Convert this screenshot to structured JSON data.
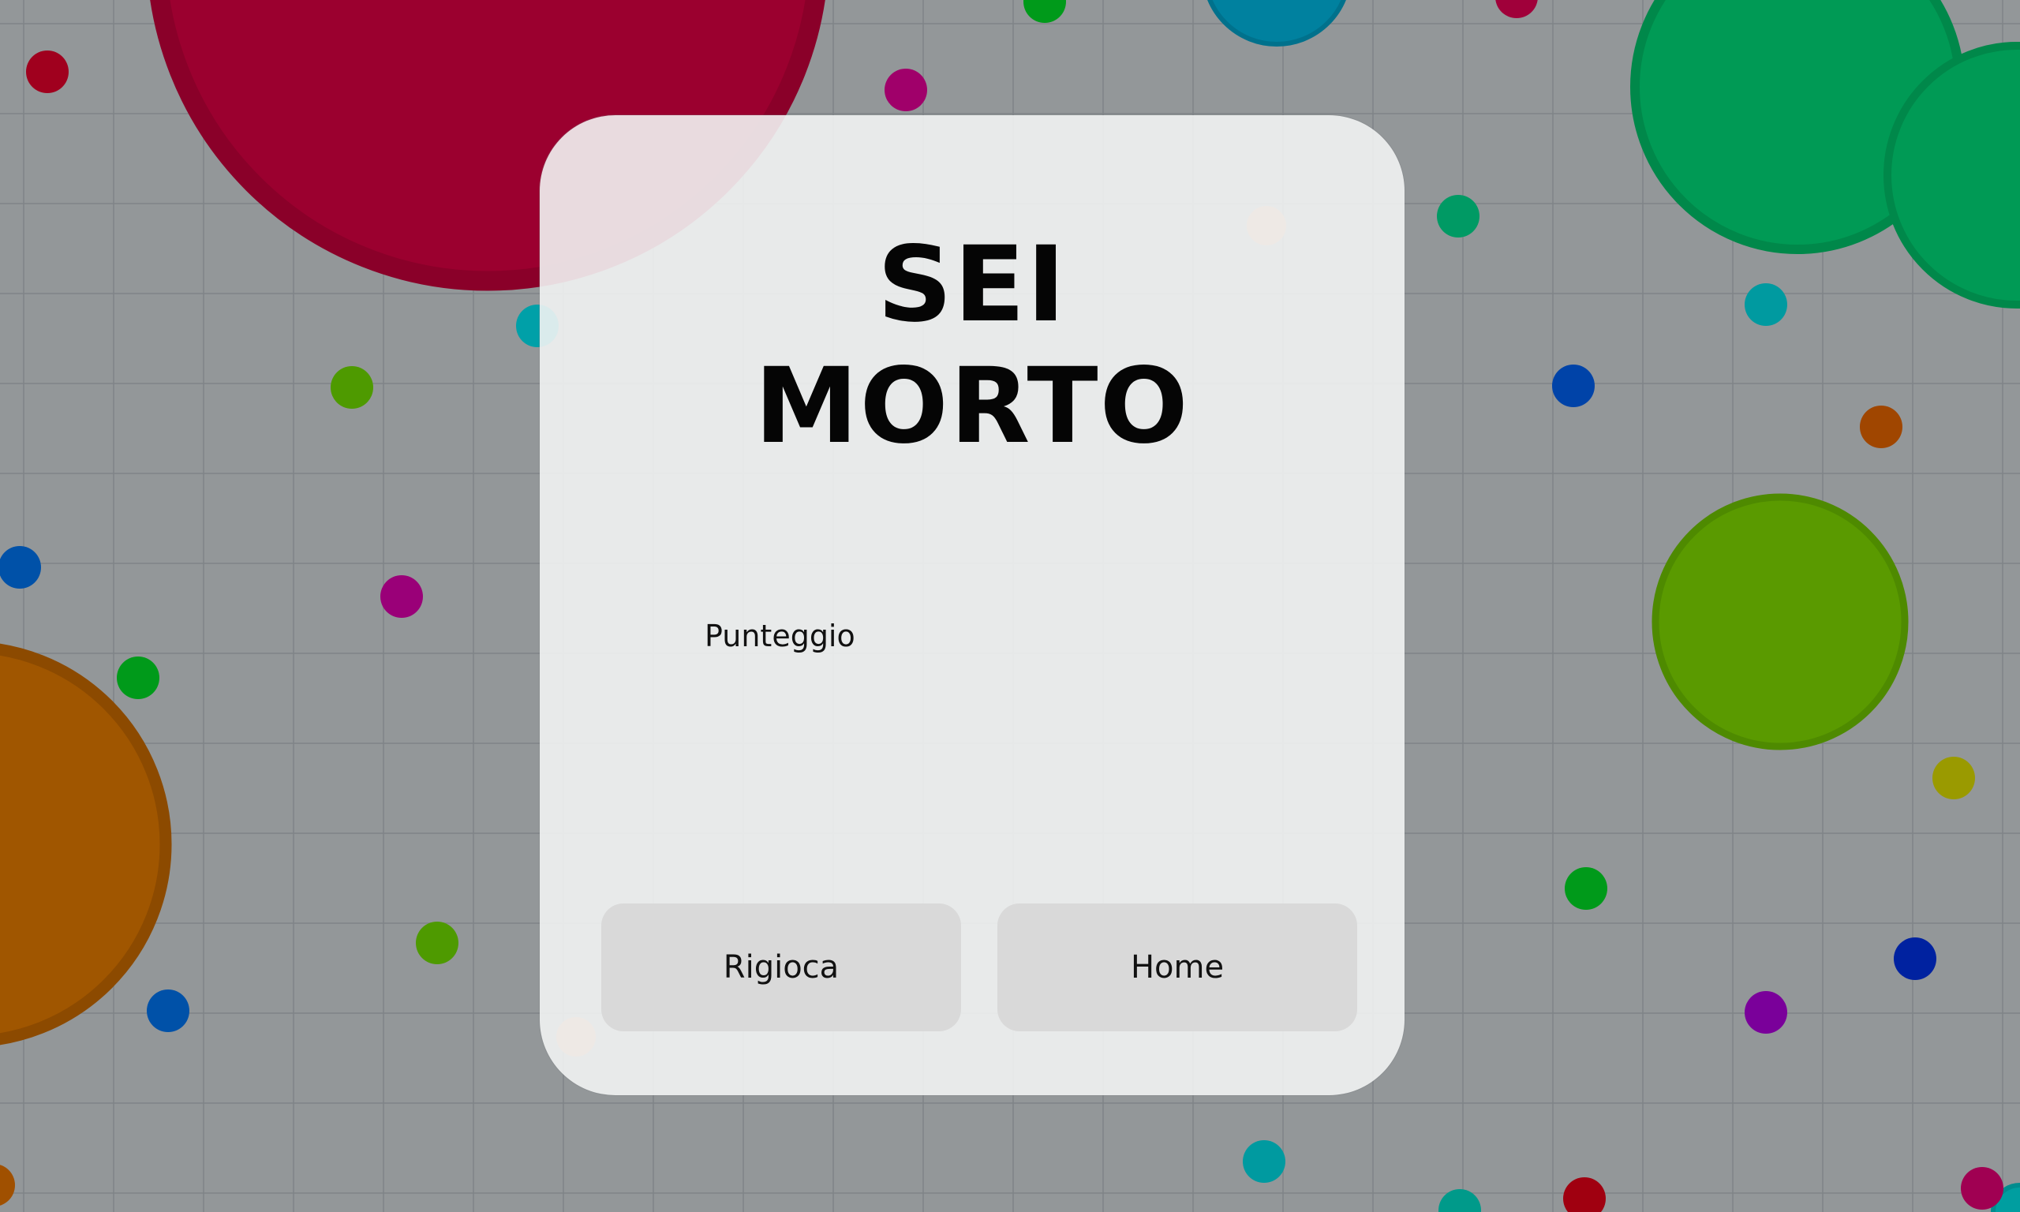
{
  "game": {
    "background_color": "#939799",
    "grid_line_color": "#7f8487",
    "cells": [
      {
        "color": "#9b002f",
        "border": "#8a0029",
        "kind": "player-cell"
      },
      {
        "color": "#009a55",
        "border": "#00884a",
        "kind": "player-cell"
      },
      {
        "color": "#009a55",
        "border": "#00884a",
        "kind": "player-cell"
      },
      {
        "color": "#5a9a00",
        "border": "#4e8a00",
        "kind": "player-cell"
      },
      {
        "color": "#a05600",
        "border": "#8c4a00",
        "kind": "player-cell"
      },
      {
        "color": "#00819f",
        "border": "#00718c",
        "kind": "player-cell"
      },
      {
        "color": "#009ea0",
        "border": "#008c8e",
        "kind": "player-cell"
      }
    ],
    "pellets": [
      "#a0001e",
      "#a0006a",
      "#009a1a",
      "#a0003a",
      "#009a64",
      "#00a0a8",
      "#4e9a00",
      "#0051a8",
      "#9a0078",
      "#009a1a",
      "#4e9a00",
      "#0051a8",
      "#0043a8",
      "#009aa0",
      "#a04600",
      "#009a1a",
      "#9a9a00",
      "#0022a0",
      "#7a009a",
      "#009aa0",
      "#a00010",
      "#009a8a",
      "#a00052",
      "#a05000"
    ]
  },
  "dialog": {
    "title_line1": "SEI",
    "title_line2": "MORTO",
    "score_label": "Punteggio",
    "replay_label": "Rigioca",
    "home_label": "Home"
  }
}
